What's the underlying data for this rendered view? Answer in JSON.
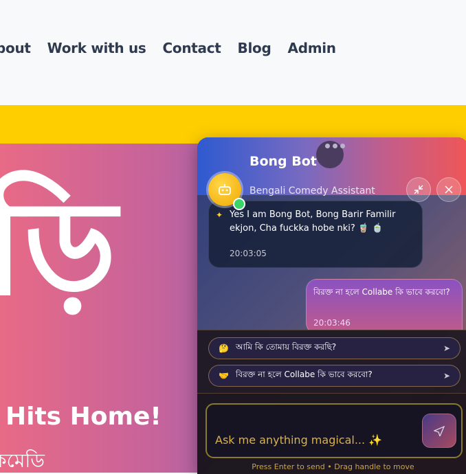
{
  "nav": {
    "items": [
      "bout",
      "Work with us",
      "Contact",
      "Blog",
      "Admin"
    ]
  },
  "hero": {
    "bengali_glyph": "ড়ি",
    "headline": "Hits Home!",
    "subtext": "কমেডি"
  },
  "chat": {
    "bot_name": "Bong Bot",
    "bot_subtitle": "Bengali Comedy Assistant",
    "icons": {
      "avatar": "robot-icon",
      "minimize": "minimize-icon",
      "close": "close-icon",
      "sparkle": "sparkle-icon",
      "send": "send-icon"
    },
    "messages": [
      {
        "sender": "bot",
        "text": "Yes I am Bong Bot, Bong Barir Familir ekjon, Cha fuckka hobe nki? 🧋 🍵",
        "time": "20:03:05"
      },
      {
        "sender": "user",
        "text": "বিরক্ত না হলে Collabe কি ভাবে করবো?",
        "time": "20:03:46"
      }
    ],
    "suggestions": [
      {
        "emoji": "🤔",
        "text": "আমি কি তোমায় বিরক্ত করছি?"
      },
      {
        "emoji": "🤝",
        "text": "বিরক্ত না হলে Collabe কি ভাবে করবো?"
      }
    ],
    "input_placeholder": "Ask me anything magical... ✨",
    "hint": "Press Enter to send • Drag handle to move"
  },
  "colors": {
    "nav_text": "#2f3a4f",
    "yellow_band": "#ffce00",
    "online": "#3bd46a",
    "avatar": "#f5b800"
  }
}
